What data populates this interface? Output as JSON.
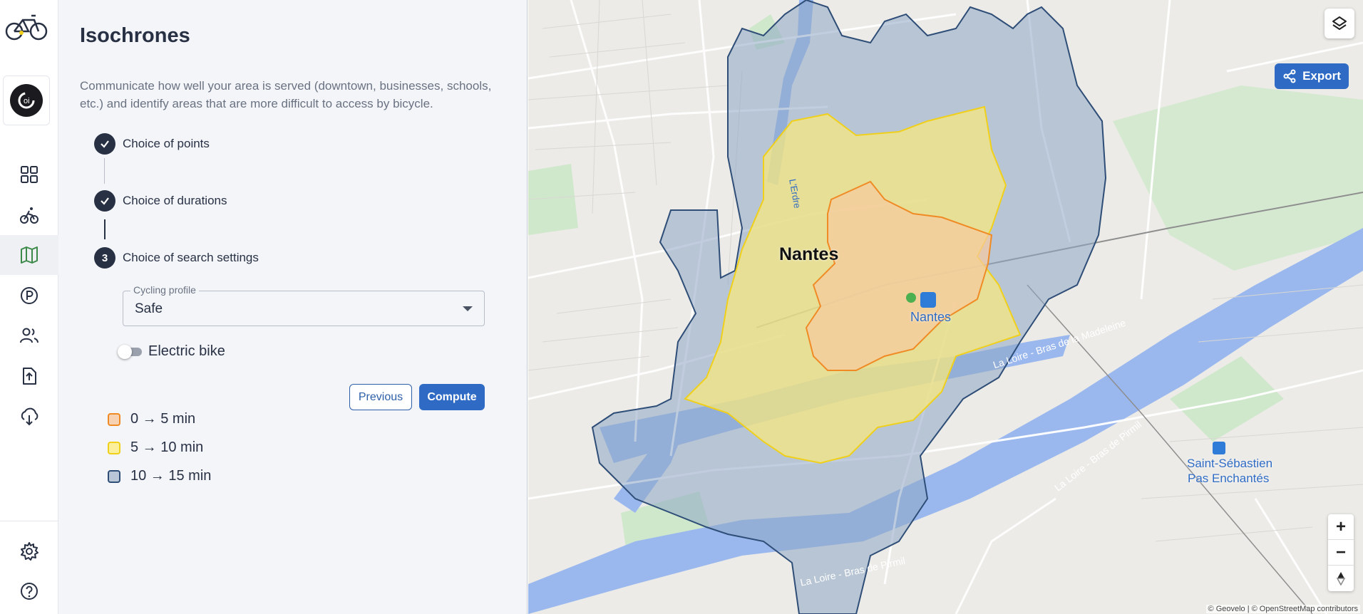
{
  "app": {
    "logo": "bike-logo",
    "org_icon": "org-avatar-icon"
  },
  "nav": {
    "items": [
      {
        "name": "dashboard-icon"
      },
      {
        "name": "cyclist-icon"
      },
      {
        "name": "map-icon",
        "active": true
      },
      {
        "name": "parking-icon"
      },
      {
        "name": "users-icon"
      },
      {
        "name": "upload-icon"
      },
      {
        "name": "cloud-download-icon"
      }
    ],
    "bottom": [
      {
        "name": "settings-icon"
      },
      {
        "name": "help-icon"
      }
    ]
  },
  "panel": {
    "title": "Isochrones",
    "description": "Communicate how well your area is served (downtown, businesses, schools, etc.) and identify areas that are more difficult to access by bicycle.",
    "steps": [
      {
        "label": "Choice of points",
        "state": "done"
      },
      {
        "label": "Choice of durations",
        "state": "done"
      },
      {
        "label": "Choice of search settings",
        "state": "active",
        "number": "3"
      }
    ],
    "cycling_profile": {
      "legend": "Cycling profile",
      "value": "Safe"
    },
    "electric_bike": {
      "label": "Electric bike",
      "checked": false
    },
    "buttons": {
      "previous": "Previous",
      "compute": "Compute"
    },
    "legend": [
      {
        "label": "0 → 5 min",
        "fill": "#f6d2b2",
        "stroke": "#f08a24"
      },
      {
        "label": "5 → 10 min",
        "fill": "#fbef9c",
        "stroke": "#f0d01a"
      },
      {
        "label": "10 → 15 min",
        "fill": "#b9c6d8",
        "stroke": "#2e4d77"
      }
    ]
  },
  "map": {
    "export_label": "Export",
    "city_label": "Nantes",
    "station_label": "Nantes",
    "station2_label_1": "Saint-Sébastien",
    "station2_label_2": "Pas Enchantés",
    "river_labels": [
      "La Loire - Bras de la Madeleine",
      "La Loire - Bras de Pirmil",
      "La Loire - Bras de Pirmil",
      "L'Erdre"
    ],
    "zoom_in": "+",
    "zoom_out": "−",
    "attribution": "© Geovelo | © OpenStreetMap contributors",
    "colors": {
      "water": "#9ab8ee",
      "green": "#cfe8cc",
      "ring15": "#2e4d77",
      "ring10": "#f0d01a",
      "ring5": "#f08a24"
    }
  }
}
